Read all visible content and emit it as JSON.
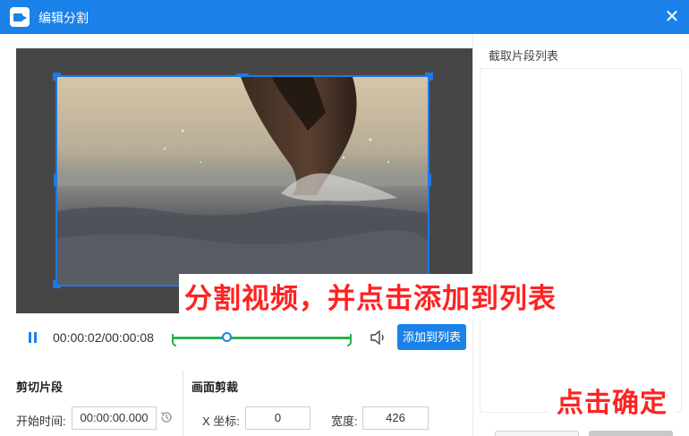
{
  "window": {
    "title": "编辑分割",
    "close_symbol": "✕"
  },
  "player": {
    "time": "00:00:02/00:00:08",
    "progress": 0.3,
    "add_button": "添加到列表"
  },
  "cut": {
    "title": "剪切片段",
    "start_label": "开始时间:",
    "start_value": "00:00:00.000"
  },
  "crop": {
    "title": "画面剪裁",
    "x_label": "X 坐标:",
    "x_value": "0",
    "width_label": "宽度:",
    "width_value": "426"
  },
  "clip_list": {
    "title": "截取片段列表"
  },
  "annotations": {
    "split_hint": "分割视频，并点击添加到列表",
    "confirm_hint": "点击确定"
  },
  "colors": {
    "accent": "#1a82e8",
    "trim": "#2bb24c",
    "callout": "#ff2222"
  }
}
